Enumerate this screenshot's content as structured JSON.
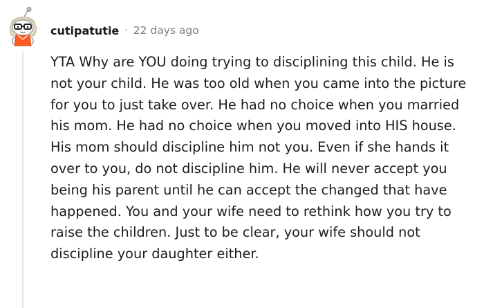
{
  "comment": {
    "author": "cutipatutie",
    "separator": "·",
    "age": "22 days ago",
    "avatar_icon": "snoo-avatar-icon",
    "body": "YTA Why are YOU doing trying to disciplining this child. He is not your child. He was too old when you came into the picture for you to just take over. He had no choice when you married his mom. He had no choice when you moved into HIS house. His mom should discipline him not you. Even if she hands it over to you, do not discipline him. He will never accept you being his parent until he can accept the changed that have happened. You and your wife need to rethink how you try to raise the children. Just to be clear, your wife should not discipline your daughter either."
  }
}
